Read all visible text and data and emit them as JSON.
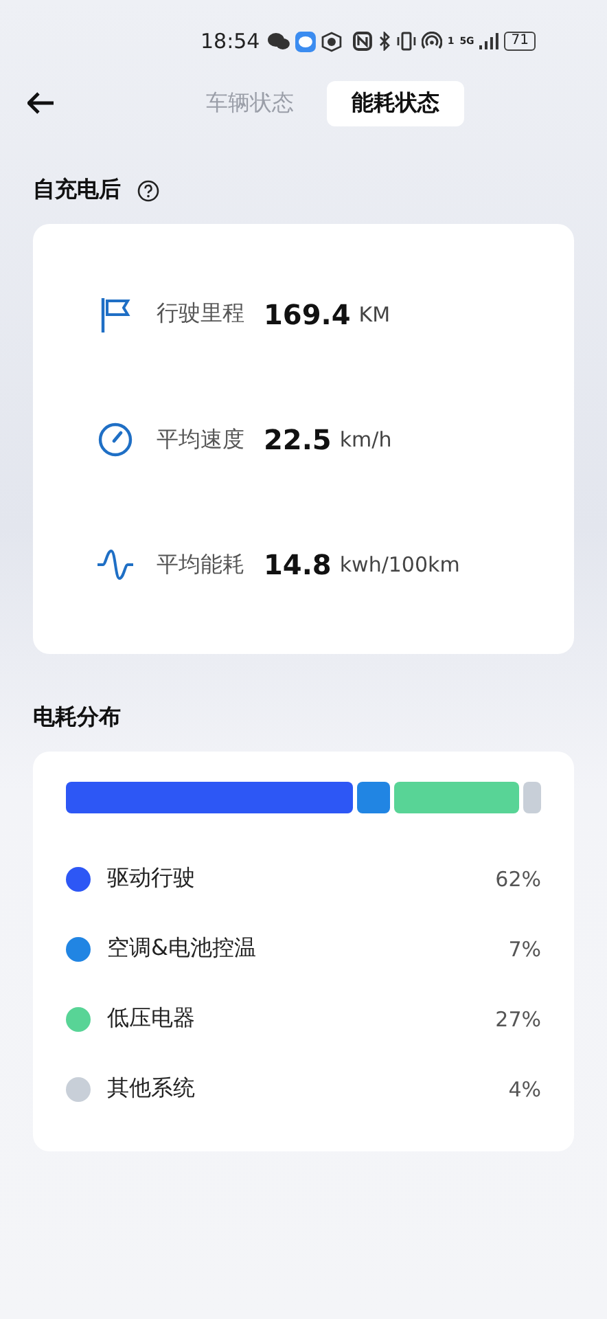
{
  "status_bar": {
    "time": "18:54",
    "network": "5G",
    "sim": "1",
    "battery": "71"
  },
  "tabs": [
    {
      "label": "车辆状态",
      "selected": false
    },
    {
      "label": "能耗状态",
      "selected": true
    }
  ],
  "summary": {
    "title": "自充电后",
    "stats": [
      {
        "kind": "distance",
        "label": "行驶里程",
        "value": "169.4",
        "unit": "KM"
      },
      {
        "kind": "speed",
        "label": "平均速度",
        "value": "22.5",
        "unit": "km/h"
      },
      {
        "kind": "consumption",
        "label": "平均能耗",
        "value": "14.8",
        "unit": "kwh/100km"
      }
    ]
  },
  "distribution": {
    "title": "电耗分布",
    "items": [
      {
        "label": "驱动行驶",
        "percent": "62%",
        "color": "#2d57f5"
      },
      {
        "label": "空调&电池控温",
        "percent": "7%",
        "color": "#2185e3"
      },
      {
        "label": "低压电器",
        "percent": "27%",
        "color": "#58d496"
      },
      {
        "label": "其他系统",
        "percent": "4%",
        "color": "#c8cfd8"
      }
    ]
  }
}
